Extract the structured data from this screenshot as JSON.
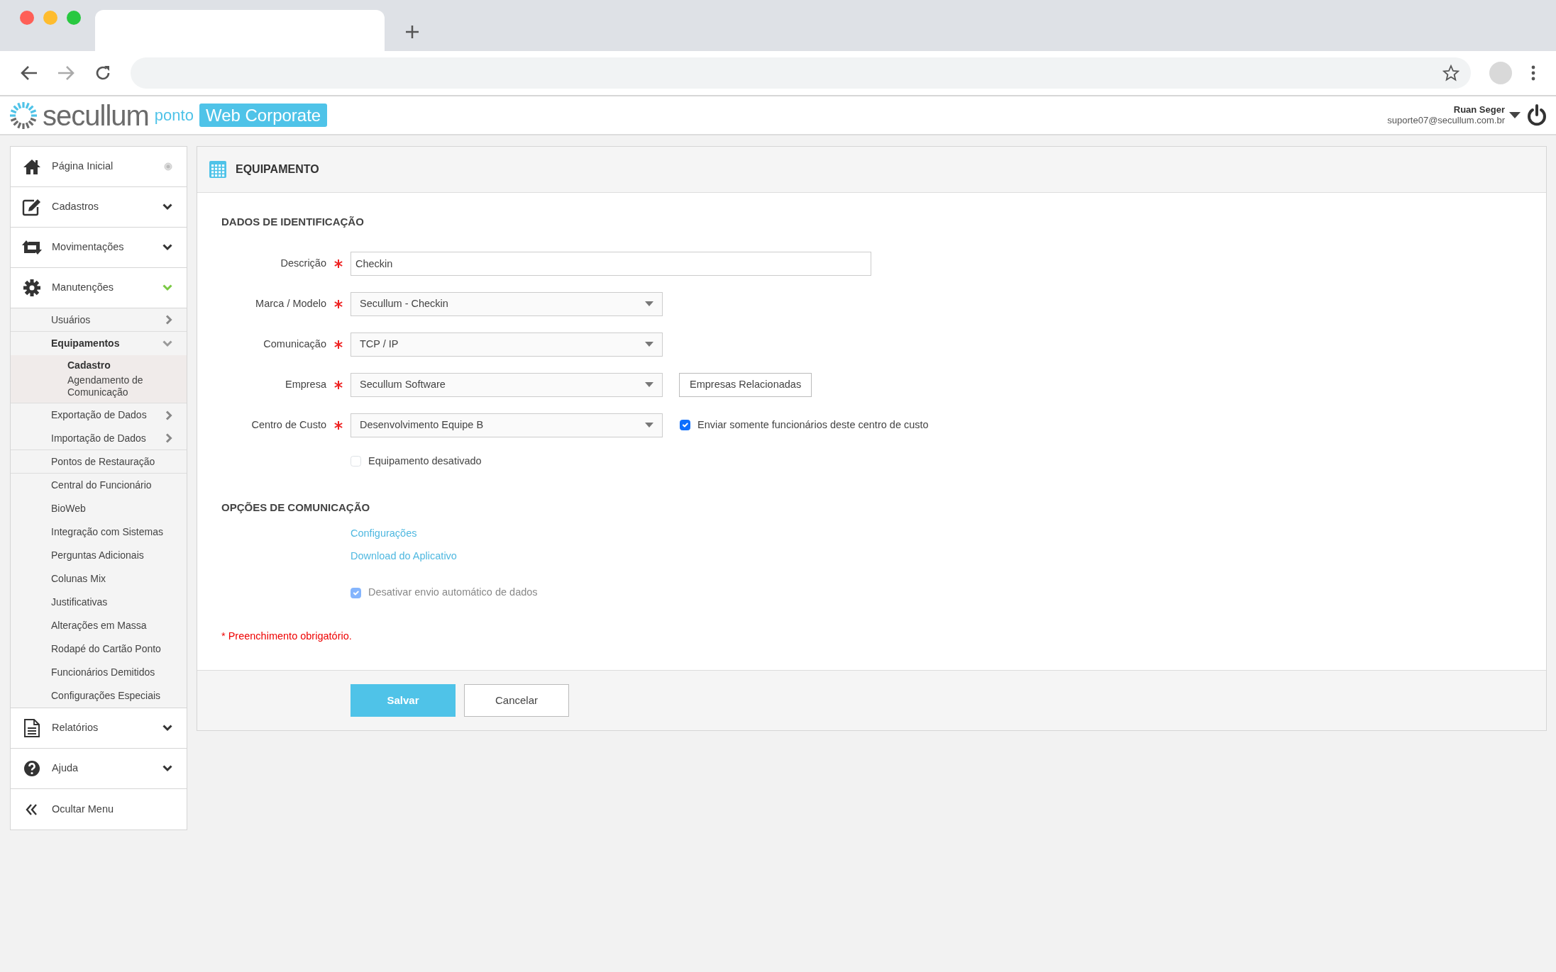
{
  "header": {
    "logo": {
      "brand": "secullum",
      "product": "ponto",
      "edition": "Web Corporate"
    },
    "user": {
      "name": "Ruan Seger",
      "email": "suporte07@secullum.com.br"
    }
  },
  "sidebar": {
    "items": [
      {
        "kind": "link",
        "label": "Página Inicial"
      },
      {
        "kind": "group",
        "label": "Cadastros",
        "expanded": false
      },
      {
        "kind": "group",
        "label": "Movimentações",
        "expanded": false
      },
      {
        "kind": "group",
        "label": "Manutenções",
        "expanded": true,
        "children": [
          {
            "kind": "group",
            "label": "Usuários",
            "expanded": false,
            "selected": false
          },
          {
            "kind": "group",
            "label": "Equipamentos",
            "expanded": true,
            "selected": true,
            "children": [
              {
                "label": "Cadastro",
                "selected": true
              },
              {
                "label": "Agendamento de Comunicação",
                "selected": false
              }
            ]
          },
          {
            "kind": "group",
            "label": "Exportação de Dados",
            "expanded": false,
            "selected": false
          },
          {
            "kind": "group",
            "label": "Importação de Dados",
            "expanded": false,
            "selected": false
          },
          {
            "kind": "link",
            "label": "Pontos de Restauração",
            "selected": false
          },
          {
            "kind": "link",
            "label": "Central do Funcionário",
            "selected": false
          },
          {
            "kind": "link",
            "label": "BioWeb",
            "selected": false
          },
          {
            "kind": "link",
            "label": "Integração com Sistemas",
            "selected": false
          },
          {
            "kind": "link",
            "label": "Perguntas Adicionais",
            "selected": false
          },
          {
            "kind": "link",
            "label": "Colunas Mix",
            "selected": false
          },
          {
            "kind": "link",
            "label": "Justificativas",
            "selected": false
          },
          {
            "kind": "link",
            "label": "Alterações em Massa",
            "selected": false
          },
          {
            "kind": "link",
            "label": "Rodapé do Cartão Ponto",
            "selected": false
          },
          {
            "kind": "link",
            "label": "Funcionários Demitidos",
            "selected": false
          },
          {
            "kind": "link",
            "label": "Configurações Especiais",
            "selected": false
          }
        ]
      },
      {
        "kind": "group",
        "label": "Relatórios",
        "expanded": false
      },
      {
        "kind": "group",
        "label": "Ajuda",
        "expanded": false
      },
      {
        "kind": "action",
        "label": "Ocultar Menu"
      }
    ]
  },
  "panel": {
    "title": "EQUIPAMENTO",
    "sections": [
      {
        "title": "DADOS DE IDENTIFICAÇÃO",
        "fields": [
          {
            "label": "Descrição",
            "required": true,
            "kind": "text",
            "value": "Checkin"
          },
          {
            "label": "Marca / Modelo",
            "required": true,
            "kind": "select",
            "value": "Secullum - Checkin"
          },
          {
            "label": "Comunicação",
            "required": true,
            "kind": "select",
            "value": "TCP / IP"
          },
          {
            "label": "Empresa",
            "required": true,
            "kind": "select",
            "value": "Secullum Software",
            "button": "Empresas Relacionadas"
          },
          {
            "label": "Centro de Custo",
            "required": true,
            "kind": "select",
            "value": "Desenvolvimento Equipe B",
            "checkbox": {
              "label": "Enviar somente funcionários deste centro de custo",
              "checked": true
            }
          }
        ],
        "checkboxes": [
          {
            "label": "Equipamento desativado",
            "checked": false,
            "disabled": false
          }
        ]
      },
      {
        "title": "OPÇÕES DE COMUNICAÇÃO",
        "links": [
          "Configurações",
          "Download do Aplicativo"
        ],
        "checkboxes": [
          {
            "label": "Desativar envio automático de dados",
            "checked": true,
            "disabled": true
          }
        ]
      }
    ],
    "note": "* Preenchimento obrigatório.",
    "buttons": [
      {
        "label": "Salvar",
        "kind": "primary"
      },
      {
        "label": "Cancelar",
        "kind": "secondary"
      }
    ]
  }
}
